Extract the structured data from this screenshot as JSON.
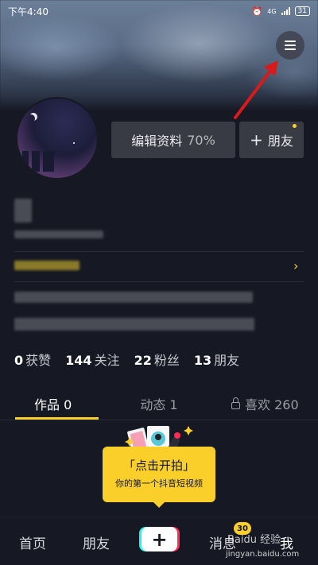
{
  "status_bar": {
    "time": "下午4:40",
    "network": "4G",
    "battery": "31"
  },
  "profile": {
    "edit_label": "编辑资料",
    "edit_percent": "70%",
    "add_friend_plus": "+",
    "add_friend_label": "朋友"
  },
  "stats": [
    {
      "num": "0",
      "label": "获赞"
    },
    {
      "num": "144",
      "label": "关注"
    },
    {
      "num": "22",
      "label": "粉丝"
    },
    {
      "num": "13",
      "label": "朋友"
    }
  ],
  "tabs": [
    {
      "label": "作品 0"
    },
    {
      "label": "动态 1"
    },
    {
      "label": "喜欢 260"
    }
  ],
  "shoot_tip": {
    "title": "「点击开拍」",
    "subtitle": "你的第一个抖音短视频"
  },
  "bottom_nav": {
    "home": "首页",
    "friends": "朋友",
    "plus": "+",
    "messages": "消息",
    "messages_badge": "30",
    "me": "我"
  },
  "watermark": {
    "text": "Baidu 经验",
    "url": "jingyan.baidu.com"
  },
  "colors": {
    "accent": "#facf2a",
    "background": "#161823",
    "arrow": "#d71a1a"
  },
  "icons": {
    "menu": "hamburger-menu-icon",
    "lock": "lock-icon",
    "chevron": "chevron-right-icon"
  }
}
